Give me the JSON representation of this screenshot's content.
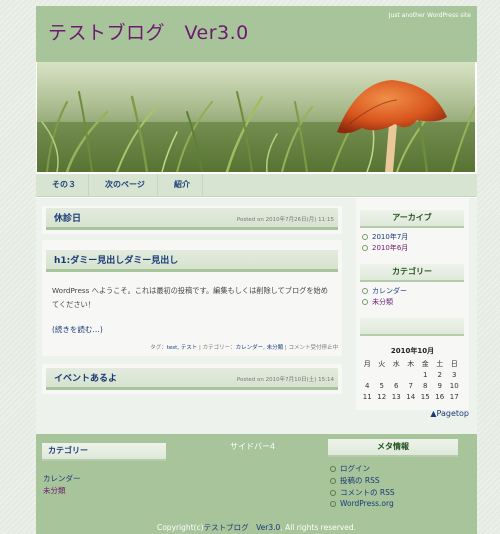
{
  "header": {
    "site_title": "テストブログ　Ver3.0",
    "tagline": "Just another WordPress site"
  },
  "nav": {
    "items": [
      "その３",
      "次のページ",
      "紹介"
    ]
  },
  "posts": [
    {
      "title": "休診日",
      "date": "Posted on 2010年7月26日(月) 11:15"
    },
    {
      "title": "h1:ダミー見出しダミー見出し",
      "body": "WordPress へようこそ。これは最初の投稿です。編集もしくは削除してブログを始めてください！",
      "more": "(続きを読む…)",
      "meta": {
        "tag_prefix": "タグ：",
        "tags": "test, テスト",
        "category_prefix": " | カテゴリー：",
        "categories": "カレンダー, 未分類",
        "comments": " | コメント受付停止中"
      }
    },
    {
      "title": "イベントあるよ",
      "date": "Posted on 2010年7月10日(土) 15:14"
    }
  ],
  "sidebar": {
    "archive_title": "アーカイブ",
    "archives": [
      "2010年7月",
      "2010年6月"
    ],
    "category_title": "カテゴリー",
    "categories": [
      "カレンダー",
      "未分類"
    ],
    "calendar": {
      "caption": "2010年10月",
      "weekdays": [
        "月",
        "火",
        "水",
        "木",
        "金",
        "土",
        "日"
      ],
      "weeks": [
        [
          "",
          "",
          "",
          "",
          "1",
          "2",
          "3"
        ],
        [
          "4",
          "5",
          "6",
          "7",
          "8",
          "9",
          "10"
        ],
        [
          "11",
          "12",
          "13",
          "14",
          "15",
          "16",
          "17"
        ]
      ]
    }
  },
  "pagetop": "▲Pagetop",
  "footer": {
    "col1_title": "カテゴリー",
    "col1_links": [
      "カレンダー",
      "未分類"
    ],
    "col2_title": "サイドバー4",
    "col3_title": "メタ情報",
    "col3_links": [
      "ログイン",
      "投稿の RSS",
      "コメントの RSS",
      "WordPress.org"
    ],
    "copyright_prefix": "Copyright(c)",
    "copyright_link": "テストブログ　Ver3.0",
    "copyright_suffix": ", All rights reserved."
  },
  "colors": {
    "header_bg": "#a7c49a",
    "title_purple": "#6b1a6e",
    "link_blue": "#1a3a78"
  }
}
